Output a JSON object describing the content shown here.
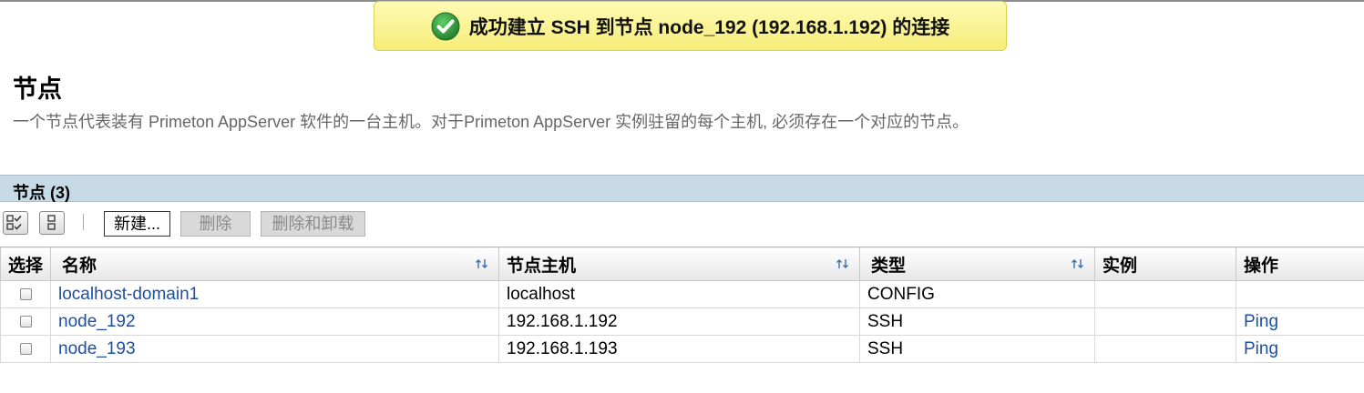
{
  "toast": {
    "icon": "check-circle-icon",
    "message": "成功建立 SSH 到节点 node_192 (192.168.1.192) 的连接",
    "accent": "#2e8b3a"
  },
  "page": {
    "title": "节点",
    "description": "一个节点代表装有 Primeton AppServer 软件的一台主机。对于Primeton AppServer 实例驻留的每个主机, 必须存在一个对应的节点。"
  },
  "table_section": {
    "title": "节点 (3)"
  },
  "toolbar": {
    "select_all_icon": "select-all-icon",
    "deselect_icon": "deselect-all-icon",
    "new_label": "新建...",
    "delete_label": "删除",
    "delete_uninstall_label": "删除和卸载"
  },
  "columns": {
    "select": "选择",
    "name": "名称",
    "host": "节点主机",
    "type": "类型",
    "instances": "实例",
    "actions": "操作"
  },
  "rows": [
    {
      "name": "localhost-domain1",
      "host": "localhost",
      "type": "CONFIG",
      "instances": "",
      "action": ""
    },
    {
      "name": "node_192",
      "host": "192.168.1.192",
      "type": "SSH",
      "instances": "",
      "action": "Ping"
    },
    {
      "name": "node_193",
      "host": "192.168.1.193",
      "type": "SSH",
      "instances": "",
      "action": "Ping"
    }
  ]
}
